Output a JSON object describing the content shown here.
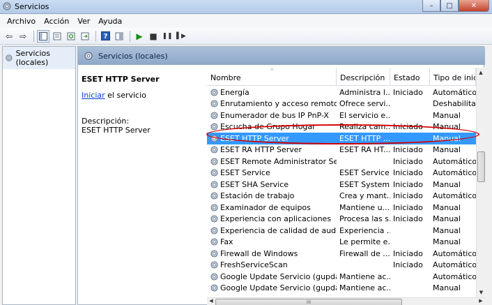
{
  "window": {
    "title": "Servicios",
    "minimize": "–",
    "maximize": "□",
    "close": "✕"
  },
  "menu": {
    "items": [
      "Archivo",
      "Acción",
      "Ver",
      "Ayuda"
    ]
  },
  "toolbar": {
    "back_icon": "⇦",
    "forward_icon": "⇨",
    "play_icon": "▶",
    "stop_icon": "■",
    "pause_icon": "❚❚",
    "restart_icon": "▌▶"
  },
  "tree": {
    "root_label": "Servicios (locales)"
  },
  "panel": {
    "header": "Servicios (locales)",
    "selected_service": "ESET HTTP Server",
    "start_link": "Iniciar",
    "start_suffix": " el servicio",
    "description_label": "Descripción:",
    "description_text": "ESET HTTP Server"
  },
  "grid": {
    "columns": [
      "Nombre",
      "Descripción",
      "Estado",
      "Tipo de inicio"
    ],
    "rows": [
      {
        "name": "Energía",
        "desc": "Administra l...",
        "state": "Iniciado",
        "type": "Automático"
      },
      {
        "name": "Enrutamiento y acceso remoto",
        "desc": "Ofrece servi...",
        "state": "",
        "type": "Deshabilitado"
      },
      {
        "name": "Enumerador de bus IP PnP-X",
        "desc": "El servicio e...",
        "state": "",
        "type": "Manual"
      },
      {
        "name": "Escucha de Grupo Hogar",
        "desc": "Realiza cam...",
        "state": "Iniciado",
        "type": "Manual"
      },
      {
        "name": "ESET HTTP Server",
        "desc": "ESET HTTP ...",
        "state": "",
        "type": "Manual"
      },
      {
        "name": "ESET RA HTTP Server",
        "desc": "ESET RA HT...",
        "state": "Iniciado",
        "type": "Manual"
      },
      {
        "name": "ESET Remote Administrator Server",
        "desc": "",
        "state": "Iniciado",
        "type": "Automático"
      },
      {
        "name": "ESET Service",
        "desc": "ESET Service",
        "state": "Iniciado",
        "type": "Automático"
      },
      {
        "name": "ESET SHA Service",
        "desc": "ESET System...",
        "state": "Iniciado",
        "type": "Manual"
      },
      {
        "name": "Estación de trabajo",
        "desc": "Crea y mant...",
        "state": "Iniciado",
        "type": "Automático"
      },
      {
        "name": "Examinador de equipos",
        "desc": "Mantiene u...",
        "state": "Iniciado",
        "type": "Manual"
      },
      {
        "name": "Experiencia con aplicaciones",
        "desc": "Procesa las s...",
        "state": "Iniciado",
        "type": "Manual"
      },
      {
        "name": "Experiencia de calidad de audio y ...",
        "desc": "Experiencia ...",
        "state": "",
        "type": "Manual"
      },
      {
        "name": "Fax",
        "desc": "Le permite e...",
        "state": "",
        "type": "Manual"
      },
      {
        "name": "Firewall de Windows",
        "desc": "Firewall de ...",
        "state": "Iniciado",
        "type": "Automático"
      },
      {
        "name": "FreshServiceScan",
        "desc": "",
        "state": "Iniciado",
        "type": "Automático"
      },
      {
        "name": "Google Update Servicio (gupdate)",
        "desc": "Mantiene ac...",
        "state": "",
        "type": "Automático (i"
      },
      {
        "name": "Google Update Servicio (gupdatem)",
        "desc": "Mantiene ac...",
        "state": "",
        "type": "Manual"
      }
    ],
    "selected_index": 4,
    "scroll_up": "▲",
    "scroll_down": "▼",
    "scroll_left": "◀",
    "scroll_right": "▶",
    "thumb_grip": "III"
  },
  "colors": {
    "selection": "#3399ff",
    "highlight_ellipse": "#d40000",
    "link": "#0044cc"
  }
}
